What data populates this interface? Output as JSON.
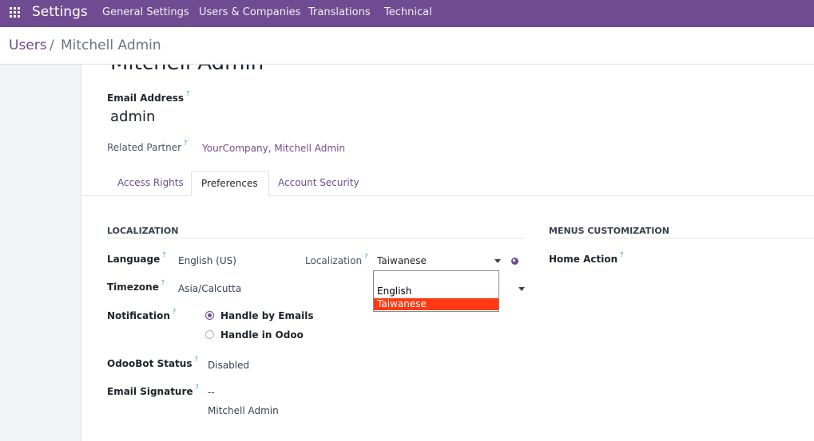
{
  "topbar": {
    "app_title": "Settings",
    "menu": [
      "General Settings",
      "Users & Companies",
      "Translations",
      "Technical"
    ]
  },
  "breadcrumb": {
    "parent": "Users",
    "separator": "/",
    "current": "Mitchell Admin"
  },
  "form": {
    "name": "Mitchell Admin",
    "email_label": "Email Address",
    "email_value": "admin",
    "related_partner_label": "Related Partner",
    "related_partner_value": "YourCompany, Mitchell Admin",
    "help_mark": "?"
  },
  "tabs": [
    "Access Rights",
    "Preferences",
    "Account Security"
  ],
  "localization": {
    "title": "LOCALIZATION",
    "language_label": "Language",
    "language_value": "English (US)",
    "localization_label": "Localization",
    "localization_value": "Taiwanese",
    "timezone_label": "Timezone",
    "timezone_value": "Asia/Calcutta",
    "notification_label": "Notification",
    "notification_options": [
      "Handle by Emails",
      "Handle in Odoo"
    ],
    "notification_selected": "Handle by Emails",
    "odoobot_label": "OdooBot Status",
    "odoobot_value": "Disabled",
    "signature_label": "Email Signature",
    "signature_line1": "--",
    "signature_line2": "Mitchell Admin"
  },
  "menus_customization": {
    "title": "MENUS CUSTOMIZATION",
    "home_action_label": "Home Action"
  },
  "dropdown": {
    "options": [
      "",
      "English",
      "Taiwanese"
    ],
    "selected": "Taiwanese"
  },
  "colors": {
    "brand": "#714B91",
    "dropdown_highlight": "#ff3a12",
    "help": "#17a2b8"
  }
}
